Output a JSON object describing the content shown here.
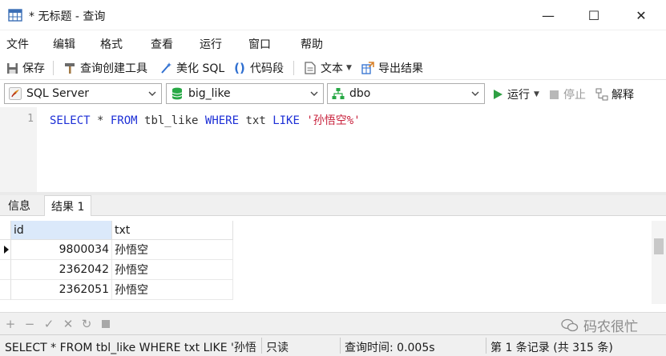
{
  "window": {
    "title": "* 无标题 - 查询",
    "minimize_glyph": "—",
    "maximize_glyph": "☐",
    "close_glyph": "✕"
  },
  "menu": [
    "文件",
    "编辑",
    "格式",
    "查看",
    "运行",
    "窗口",
    "帮助"
  ],
  "toolbar": {
    "save": "保存",
    "query_builder": "查询创建工具",
    "beautify": "美化 SQL",
    "code_snippet": "代码段",
    "text": "文本",
    "export": "导出结果"
  },
  "connection": {
    "server_type": "SQL Server",
    "database": "big_like",
    "schema": "dbo",
    "run": "运行",
    "stop": "停止",
    "explain": "解释"
  },
  "editor": {
    "line_number": "1",
    "sql": {
      "select": "SELECT",
      "star": " * ",
      "from": "FROM",
      "table": " tbl_like ",
      "where": "WHERE",
      "col": " txt ",
      "like": "LIKE",
      "space": " ",
      "pattern": "'孙悟空%'"
    }
  },
  "tabs": [
    "信息",
    "结果 1"
  ],
  "results": {
    "columns": [
      "id",
      "txt"
    ],
    "rows": [
      {
        "id": "9800034",
        "txt": "孙悟空"
      },
      {
        "id": "2362042",
        "txt": "孙悟空"
      },
      {
        "id": "2362051",
        "txt": "孙悟空"
      }
    ]
  },
  "grid_actions": [
    "add-icon",
    "remove-icon",
    "apply-icon",
    "discard-icon",
    "refresh-icon",
    "stop-icon"
  ],
  "watermark": "码农很忙",
  "status": {
    "query": "SELECT * FROM tbl_like WHERE txt LIKE '孙悟",
    "mode": "只读",
    "time": "查询时间: 0.005s",
    "records": "第 1 条记录 (共 315 条)"
  },
  "colors": {
    "keyword": "#1d2fd6",
    "string": "#c8203b",
    "run_green": "#2ea043"
  }
}
